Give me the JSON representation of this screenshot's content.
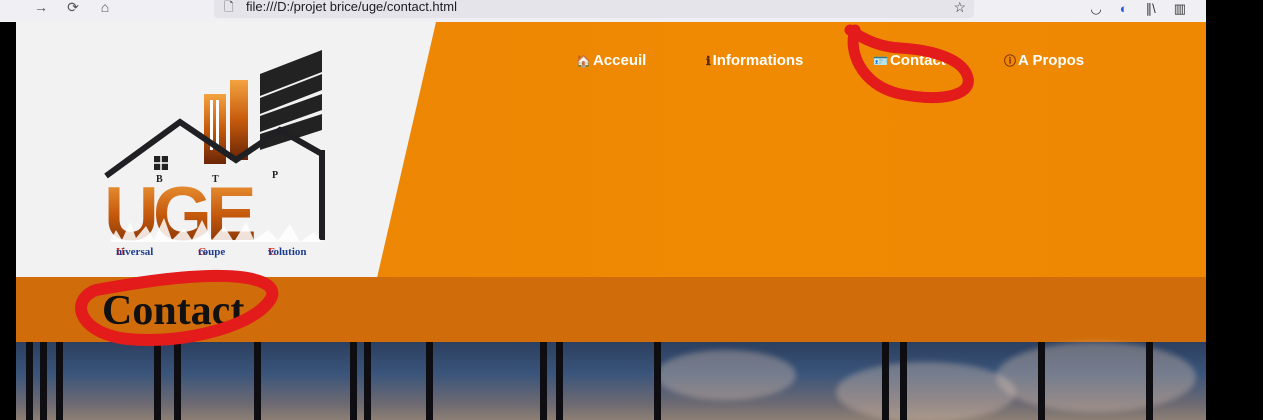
{
  "browser": {
    "url": "file:///D:/projet brice/uge/contact.html",
    "back_icon": "arrow-right-icon",
    "reload_icon": "reload-icon",
    "home_icon": "home-icon"
  },
  "logo": {
    "mark_letters": "UGE",
    "sub_letters": [
      "B",
      "T",
      "P"
    ],
    "tagline_parts": [
      {
        "initial": "U",
        "rest": "niversal"
      },
      {
        "initial": "G",
        "rest": "roupe"
      },
      {
        "initial": "E",
        "rest": "volution"
      }
    ]
  },
  "nav": [
    {
      "label": "Acceuil",
      "icon": "house-icon"
    },
    {
      "label": "Informations",
      "icon": "info-icon"
    },
    {
      "label": "Contact",
      "icon": "contact-card-icon"
    },
    {
      "label": "A Propos",
      "icon": "info-circle-icon"
    }
  ],
  "page": {
    "title": "Contact"
  },
  "colors": {
    "hero_orange": "#ee8803",
    "band_orange": "#d06d0a",
    "annotation_red": "#e31b1b"
  }
}
